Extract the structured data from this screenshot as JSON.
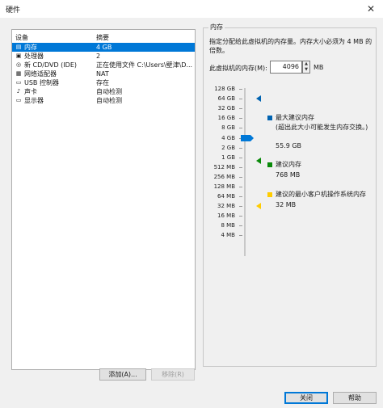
{
  "window": {
    "title": "硬件"
  },
  "devices": {
    "col_device": "设备",
    "col_summary": "摘要",
    "rows": [
      {
        "icon": "memory-icon",
        "name": "内存",
        "summary": "4 GB",
        "selected": true
      },
      {
        "icon": "cpu-icon",
        "name": "处理器",
        "summary": "2",
        "selected": false
      },
      {
        "icon": "cd-icon",
        "name": "新 CD/DVD (IDE)",
        "summary": "正在使用文件 C:\\Users\\壁津\\D...",
        "selected": false
      },
      {
        "icon": "network-icon",
        "name": "网络适配器",
        "summary": "NAT",
        "selected": false
      },
      {
        "icon": "usb-icon",
        "name": "USB 控制器",
        "summary": "存在",
        "selected": false
      },
      {
        "icon": "sound-icon",
        "name": "声卡",
        "summary": "自动检测",
        "selected": false
      },
      {
        "icon": "display-icon",
        "name": "显示器",
        "summary": "自动检测",
        "selected": false
      }
    ],
    "add_label": "添加(A)...",
    "remove_label": "移除(R)"
  },
  "memory": {
    "group_title": "内存",
    "description": "指定分配给此虚拟机的内存量。内存大小必须为 4 MB 的倍数。",
    "input_label": "此虚拟机的内存(M):",
    "value": "4096",
    "unit": "MB",
    "scale_labels": [
      "128 GB",
      "64 GB",
      "32 GB",
      "16 GB",
      "8 GB",
      "4 GB",
      "2 GB",
      "1 GB",
      "512 MB",
      "256 MB",
      "128 MB",
      "64 MB",
      "32 MB",
      "16 MB",
      "8 MB",
      "4 MB"
    ],
    "max_label": "最大建议内存",
    "max_note": "(超出此大小可能发生内存交换。)",
    "max_value": "55.9 GB",
    "rec_label": "建议内存",
    "rec_value": "768 MB",
    "min_label": "建议的最小客户机操作系统内存",
    "min_value": "32 MB",
    "colors": {
      "max": "#0063b1",
      "rec": "#0a8a0a",
      "min": "#ffcc00",
      "accent": "#0078d7"
    }
  },
  "footer": {
    "close_label": "关闭",
    "help_label": "帮助"
  }
}
